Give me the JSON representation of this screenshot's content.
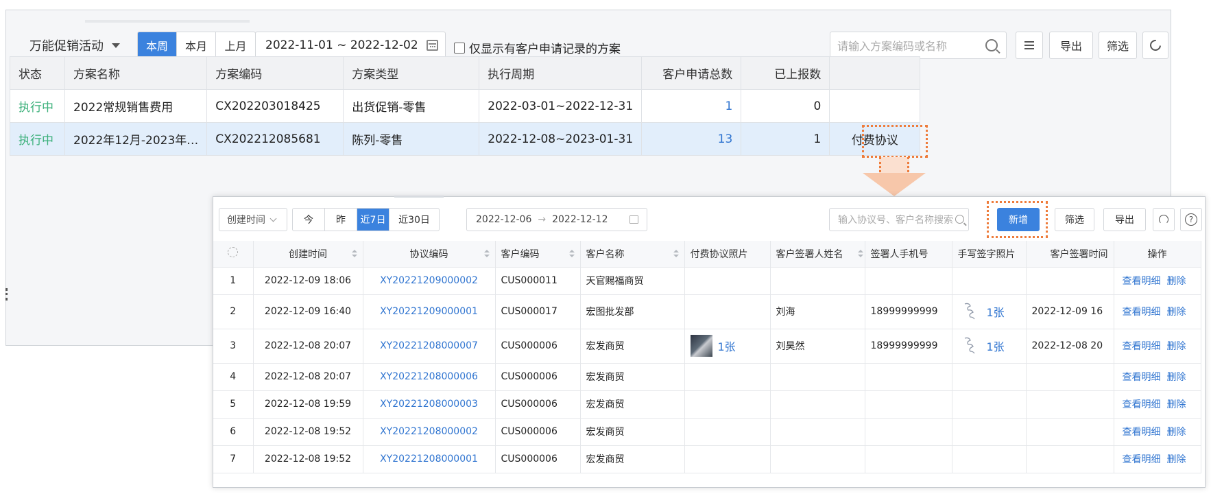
{
  "campaign": {
    "selector_label": "万能促销活动",
    "period_tabs": [
      "本周",
      "本月",
      "上月"
    ],
    "active_period": 0,
    "date_range": "2022-11-01 ~ 2022-12-02",
    "only_with_requests_label": "仅显示有客户申请记录的方案",
    "search_placeholder": "请输入方案编码或名称",
    "export_label": "导出",
    "filter_label": "筛选",
    "columns": [
      "状态",
      "方案名称",
      "方案编码",
      "方案类型",
      "执行周期",
      "客户申请总数",
      "已上报数"
    ],
    "rows": [
      {
        "status": "执行中",
        "name": "2022常规销售费用",
        "code": "CX202203018425",
        "type": "出货促销-零售",
        "period": "2022-03-01~2022-12-31",
        "requests": "1",
        "reported": "0",
        "action": ""
      },
      {
        "status": "执行中",
        "name": "2022年12月-2023年…",
        "code": "CX202212085681",
        "type": "陈列-零售",
        "period": "2022-12-08~2023-01-31",
        "requests": "13",
        "reported": "1",
        "action": "付费协议"
      }
    ]
  },
  "agreements": {
    "time_field_label": "创建时间",
    "quick_tabs": [
      "今",
      "昨",
      "近7日",
      "近30日"
    ],
    "active_tab": 2,
    "date_from": "2022-12-06",
    "date_to": "2022-12-12",
    "date_sep": "→",
    "search_placeholder": "输入协议号、客户名称搜索",
    "new_label": "新增",
    "filter_label": "筛选",
    "export_label": "导出",
    "help_label": "?",
    "columns": [
      "创建时间",
      "协议编码",
      "客户编码",
      "客户名称",
      "付费协议照片",
      "客户签署人姓名",
      "签署人手机号",
      "手写签字照片",
      "客户签署时间",
      "操作"
    ],
    "view_label": "查看明细",
    "delete_label": "删除",
    "rows": [
      {
        "idx": "1",
        "created": "2022-12-09 18:06",
        "code": "XY20221209000002",
        "cust_code": "CUS000011",
        "cust_name": "天官赐福商贸",
        "photo": "",
        "signer": "",
        "phone": "",
        "sign_photo": "",
        "sign_time": ""
      },
      {
        "idx": "2",
        "created": "2022-12-09 16:40",
        "code": "XY20221209000001",
        "cust_code": "CUS000017",
        "cust_name": "宏图批发部",
        "photo": "",
        "signer": "刘海",
        "phone": "18999999999",
        "sign_photo": "1张",
        "sign_time": "2022-12-09 16"
      },
      {
        "idx": "3",
        "created": "2022-12-08 20:07",
        "code": "XY20221208000007",
        "cust_code": "CUS000006",
        "cust_name": "宏发商贸",
        "photo": "1张",
        "signer": "刘昊然",
        "phone": "18999999999",
        "sign_photo": "1张",
        "sign_time": "2022-12-08 20"
      },
      {
        "idx": "4",
        "created": "2022-12-08 20:07",
        "code": "XY20221208000006",
        "cust_code": "CUS000006",
        "cust_name": "宏发商贸",
        "photo": "",
        "signer": "",
        "phone": "",
        "sign_photo": "",
        "sign_time": ""
      },
      {
        "idx": "5",
        "created": "2022-12-08 19:59",
        "code": "XY20221208000003",
        "cust_code": "CUS000006",
        "cust_name": "宏发商贸",
        "photo": "",
        "signer": "",
        "phone": "",
        "sign_photo": "",
        "sign_time": ""
      },
      {
        "idx": "6",
        "created": "2022-12-08 19:52",
        "code": "XY20221208000002",
        "cust_code": "CUS000006",
        "cust_name": "宏发商贸",
        "photo": "",
        "signer": "",
        "phone": "",
        "sign_photo": "",
        "sign_time": ""
      },
      {
        "idx": "7",
        "created": "2022-12-08 19:52",
        "code": "XY20221208000001",
        "cust_code": "CUS000006",
        "cust_name": "宏发商贸",
        "photo": "",
        "signer": "",
        "phone": "",
        "sign_photo": "",
        "sign_time": ""
      }
    ]
  },
  "colors": {
    "primary": "#3b82de",
    "status_running": "#3bb07a",
    "link": "#2f74d0",
    "highlight": "#ee7c3b"
  },
  "icons": [
    "chevron-down-icon",
    "calendar-icon",
    "search-icon",
    "column-settings-icon",
    "refresh-icon",
    "gear-icon",
    "sort-icon",
    "help-icon",
    "arrow-down-icon"
  ]
}
